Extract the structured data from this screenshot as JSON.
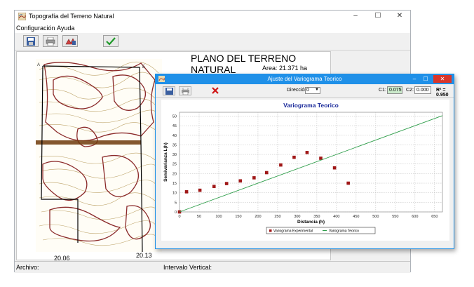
{
  "main_window": {
    "title": "Topografía del Terreno Natural",
    "controls": {
      "minimize": "–",
      "maximize": "☐",
      "close": "✕"
    }
  },
  "menu": {
    "items": [
      "Configuración",
      "Ayuda"
    ]
  },
  "toolbar": {
    "icons": [
      "save-icon",
      "print-icon",
      "profile-icon",
      "accept-check-icon"
    ]
  },
  "plan": {
    "title": "PLANO DEL TERRENO NATURAL",
    "area_text": "Area: 21.371 ha",
    "labels": {
      "bottom_left": "20.06",
      "bottom_right": "20.13"
    }
  },
  "statusbar": {
    "left": "Archivo:",
    "right": "Intervalo Vertical:"
  },
  "dialog": {
    "title": "Ajuste del Variograma Teorico",
    "controls": {
      "minimize": "–",
      "maximize": "☐",
      "close": "✕"
    },
    "direction_label": "Dirección:",
    "direction_value": "0",
    "c1_label": "C1:",
    "c1_value": "0.075",
    "c2_label": "C2:",
    "c2_value": "0.000",
    "r2_text": "R² = 0.950"
  },
  "chart_data": {
    "type": "scatter",
    "title": "Variograma Teorico",
    "xlabel": "Distancia (h)",
    "ylabel": "Semivarianza L(h)",
    "xlim": [
      0,
      670
    ],
    "ylim": [
      0,
      52
    ],
    "xticks": [
      0,
      50,
      100,
      150,
      200,
      250,
      300,
      350,
      400,
      450,
      500,
      550,
      600,
      650
    ],
    "yticks": [
      0,
      5,
      10,
      15,
      20,
      25,
      30,
      35,
      40,
      45,
      50
    ],
    "grid": true,
    "legend_position": "bottom",
    "series": [
      {
        "name": "Variograma Experimental",
        "kind": "points",
        "color": "#a01818",
        "x": [
          0,
          18,
          52,
          88,
          120,
          155,
          190,
          222,
          258,
          292,
          325,
          360,
          395,
          430
        ],
        "y": [
          0,
          10.5,
          11.3,
          13.3,
          14.8,
          16.2,
          17.8,
          20.5,
          24.5,
          28.5,
          31,
          28,
          23,
          15
        ]
      },
      {
        "name": "Variograma Teorico",
        "kind": "line",
        "color": "#2e9e4a",
        "x": [
          0,
          670
        ],
        "y": [
          0,
          50.25
        ]
      }
    ]
  },
  "colors": {
    "dialog_title_bg": "#1f90e8",
    "chart_title": "#1a2a9a",
    "contour": "#8b2a2a",
    "contour_light": "#b79a5a"
  }
}
